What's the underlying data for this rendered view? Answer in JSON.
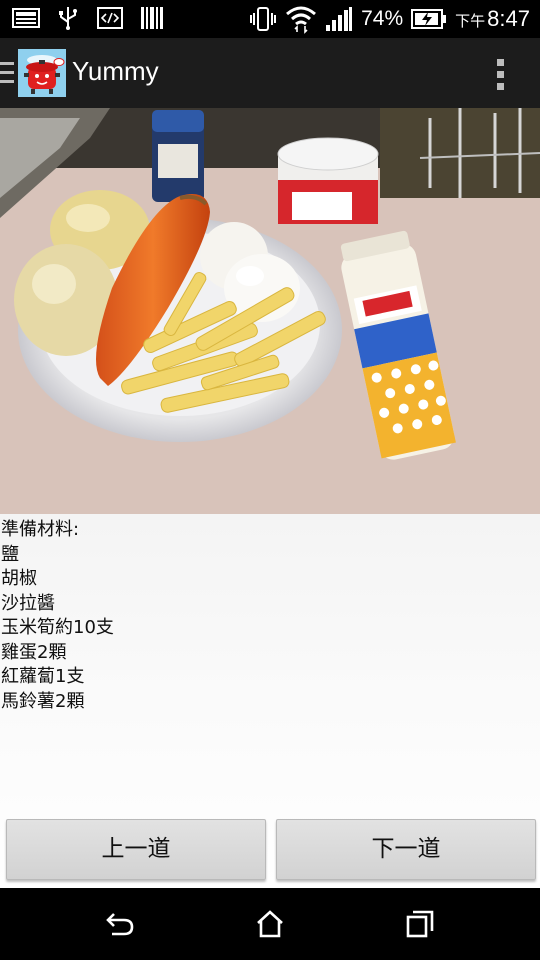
{
  "status_bar": {
    "battery_percent": "74%",
    "time_prefix": "下午",
    "time": "8:47",
    "icons": [
      "image-notification-icon",
      "usb-icon",
      "developer-icon",
      "barcode-icon",
      "vibrate-icon",
      "wifi-icon",
      "signal-icon",
      "battery-charging-icon"
    ]
  },
  "action_bar": {
    "title": "Yummy",
    "icons": [
      "drawer-indicator-icon",
      "app-logo-icon",
      "overflow-menu-icon"
    ]
  },
  "recipe": {
    "heading": "準備材料:",
    "ingredients": [
      "鹽",
      "胡椒",
      "沙拉醬",
      "玉米筍約10支",
      "雞蛋2顆",
      "紅蘿蔔1支",
      "馬鈴薯2顆"
    ]
  },
  "buttons": {
    "previous": "上一道",
    "next": "下一道"
  },
  "nav_bar": {
    "icons": [
      "back-icon",
      "home-icon",
      "recent-apps-icon"
    ]
  }
}
